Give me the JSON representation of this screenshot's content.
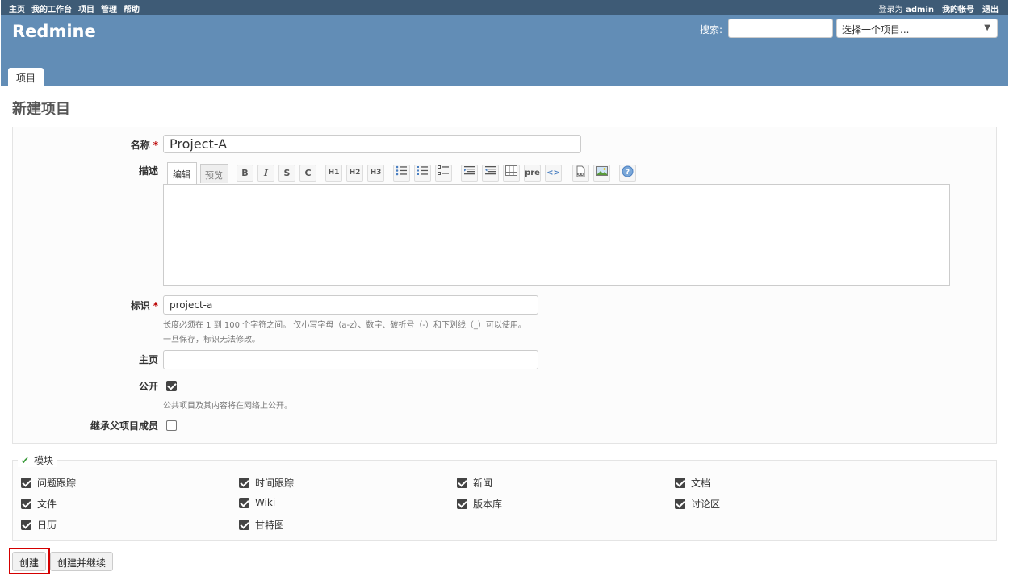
{
  "top_menu": {
    "items": [
      "主页",
      "我的工作台",
      "项目",
      "管理",
      "帮助"
    ],
    "login_prefix": "登录为",
    "login_user": "admin",
    "my_account": "我的帐号",
    "logout": "退出"
  },
  "header": {
    "app_title": "Redmine",
    "search_label": "搜索:",
    "search_value": "",
    "project_select": "选择一个项目...",
    "tab": "项目"
  },
  "page": {
    "title": "新建项目"
  },
  "form": {
    "name_label": "名称",
    "name_value": "Project-A",
    "description_label": "描述",
    "editor_tab_edit": "编辑",
    "editor_tab_preview": "预览",
    "toolbar": [
      "B",
      "I",
      "S",
      "C",
      "H1",
      "H2",
      "H3",
      "ul",
      "ol",
      "todo",
      "indent",
      "outdent",
      "table",
      "pre",
      "code",
      "link",
      "image",
      "help"
    ],
    "toolbar_pre": "pre",
    "toolbar_code": "<>",
    "identifier_label": "标识",
    "identifier_value": "project-a",
    "identifier_hint1": "长度必须在 1 到 100 个字符之间。 仅小写字母（a-z）、数字、破折号（-）和下划线（_）可以使用。",
    "identifier_hint2": "一旦保存，标识无法修改。",
    "homepage_label": "主页",
    "homepage_value": "",
    "public_label": "公开",
    "public_checked": true,
    "public_hint": "公共项目及其内容将在网络上公开。",
    "inherit_label": "继承父项目成员",
    "inherit_checked": false,
    "required_mark": "*"
  },
  "modules": {
    "legend": "模块",
    "items": [
      {
        "label": "问题跟踪",
        "checked": true
      },
      {
        "label": "时间跟踪",
        "checked": true
      },
      {
        "label": "新闻",
        "checked": true
      },
      {
        "label": "文档",
        "checked": true
      },
      {
        "label": "文件",
        "checked": true
      },
      {
        "label": "Wiki",
        "checked": true
      },
      {
        "label": "版本库",
        "checked": true
      },
      {
        "label": "讨论区",
        "checked": true
      },
      {
        "label": "日历",
        "checked": true
      },
      {
        "label": "甘特图",
        "checked": true
      }
    ]
  },
  "buttons": {
    "create": "创建",
    "create_continue": "创建并继续"
  },
  "colors": {
    "top_menu_bg": "#3e5b76",
    "header_bg": "#628db6",
    "required": "#bb0000",
    "highlight": "#d40000"
  }
}
